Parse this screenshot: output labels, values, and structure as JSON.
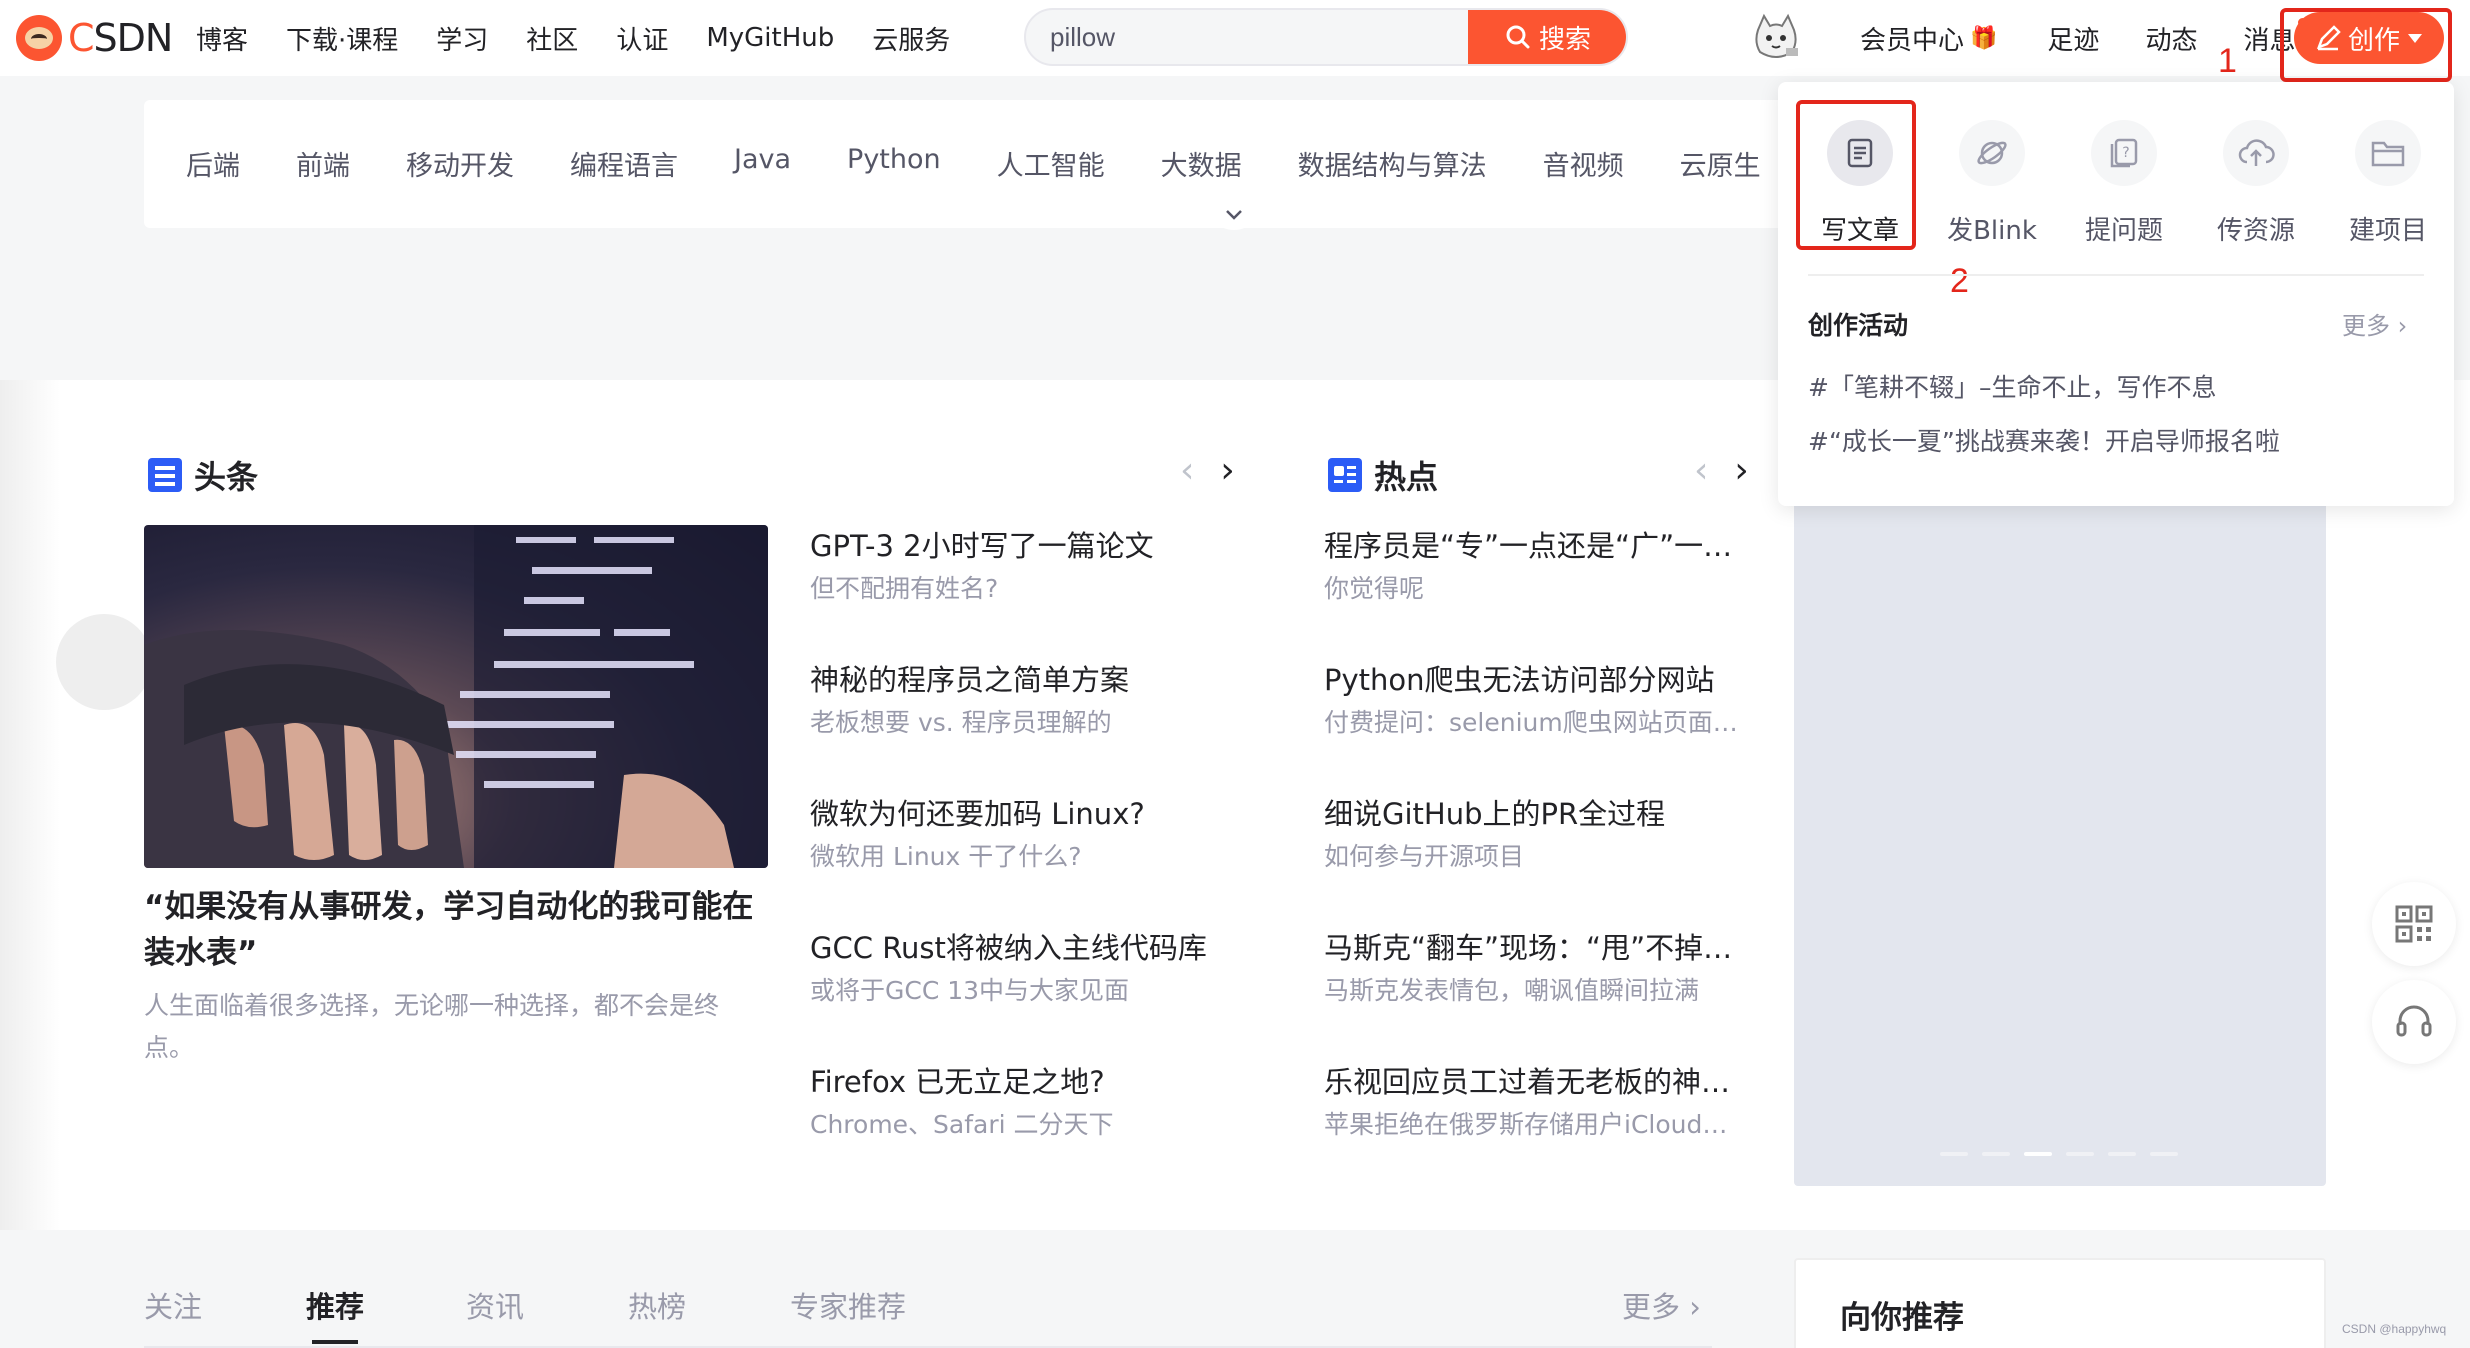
{
  "header": {
    "logo_text_c": "C",
    "logo_text_rest": "SDN",
    "nav": [
      "博客",
      "下载·课程",
      "学习",
      "社区",
      "认证",
      "MyGitHub",
      "云服务"
    ],
    "search_value": "pillow",
    "search_button": "搜索",
    "member": "会员中心",
    "footprint": "足迹",
    "dynamic": "动态",
    "message": "消息",
    "create": "创作"
  },
  "markers": {
    "one": "1",
    "two": "2"
  },
  "categories": [
    "后端",
    "前端",
    "移动开发",
    "编程语言",
    "Java",
    "Python",
    "人工智能",
    "大数据",
    "数据结构与算法",
    "音视频",
    "云原生"
  ],
  "headline": {
    "title": "头条",
    "feature_title": "“如果没有从事研发，学习自动化的我可能在装水表”",
    "feature_desc": "人生面临着很多选择，无论哪一种选择，都不会是终点。",
    "items": [
      {
        "title": "GPT-3 2小时写了一篇论文",
        "sub": "但不配拥有姓名?"
      },
      {
        "title": "神秘的程序员之简单方案",
        "sub": "老板想要 vs. 程序员理解的"
      },
      {
        "title": "微软为何还要加码 Linux?",
        "sub": "微软用 Linux 干了什么?"
      },
      {
        "title": "GCC Rust将被纳入主线代码库",
        "sub": "或将于GCC 13中与大家见面"
      },
      {
        "title": "Firefox 已无立足之地?",
        "sub": "Chrome、Safari 二分天下"
      }
    ]
  },
  "hot": {
    "title": "热点",
    "items": [
      {
        "title": "程序员是“专”一点还是“广”一点?",
        "sub": "你觉得呢"
      },
      {
        "title": "Python爬虫无法访问部分网站",
        "sub": "付费提问：selenium爬虫网站页面无法访问"
      },
      {
        "title": "细说GitHub上的PR全过程",
        "sub": "如何参与开源项目"
      },
      {
        "title": "马斯克“翻车”现场：“甩”不掉的人",
        "sub": "马斯克发表情包，嘲讽值瞬间拉满"
      },
      {
        "title": "乐视回应员工过着无老板的神仙日子",
        "sub": "苹果拒绝在俄罗斯存储用户iCloud数据"
      }
    ]
  },
  "tabs": {
    "items": [
      "关注",
      "推荐",
      "资讯",
      "热榜",
      "专家推荐"
    ],
    "active_index": 1,
    "more": "更多"
  },
  "recommend_title": "向你推荐",
  "dropdown": {
    "actions": [
      "写文章",
      "发Blink",
      "提问题",
      "传资源",
      "建项目"
    ],
    "activity_title": "创作活动",
    "more": "更多",
    "topics": [
      "#「笔耕不辍」–生命不止，写作不息",
      "#“成长一夏”挑战赛来袭！开启导师报名啦"
    ]
  },
  "carousel": {
    "slide_count": 6,
    "active_slide": 2
  },
  "watermark": "CSDN @happyhwq",
  "colors": {
    "brand": "#fc5531",
    "annotation": "#e3261b",
    "link_blue": "#2c5cf6"
  }
}
